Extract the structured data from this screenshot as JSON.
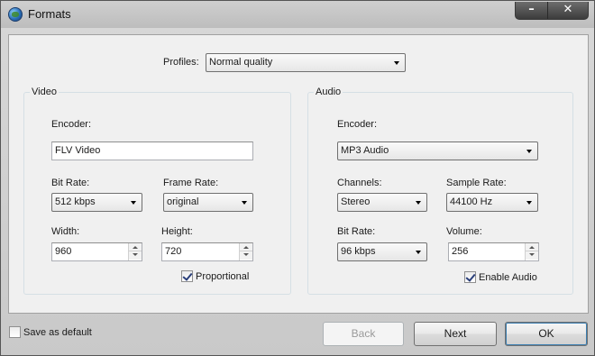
{
  "window": {
    "title": "Formats",
    "minimize_label": "–",
    "close_label": "✕"
  },
  "profiles": {
    "label": "Profiles:",
    "value": "Normal quality"
  },
  "video": {
    "group_title": "Video",
    "encoder_label": "Encoder:",
    "encoder_value": "FLV Video",
    "bitrate_label": "Bit Rate:",
    "bitrate_value": "512 kbps",
    "framerate_label": "Frame Rate:",
    "framerate_value": "original",
    "width_label": "Width:",
    "width_value": "960",
    "height_label": "Height:",
    "height_value": "720",
    "proportional_label": "Proportional",
    "proportional_checked": true
  },
  "audio": {
    "group_title": "Audio",
    "encoder_label": "Encoder:",
    "encoder_value": "MP3 Audio",
    "channels_label": "Channels:",
    "channels_value": "Stereo",
    "samplerate_label": "Sample Rate:",
    "samplerate_value": "44100 Hz",
    "bitrate_label": "Bit Rate:",
    "bitrate_value": "96 kbps",
    "volume_label": "Volume:",
    "volume_value": "256",
    "enable_audio_label": "Enable Audio",
    "enable_audio_checked": true
  },
  "footer": {
    "save_default_label": "Save as default",
    "save_default_checked": false,
    "back_label": "Back",
    "next_label": "Next",
    "ok_label": "OK"
  }
}
